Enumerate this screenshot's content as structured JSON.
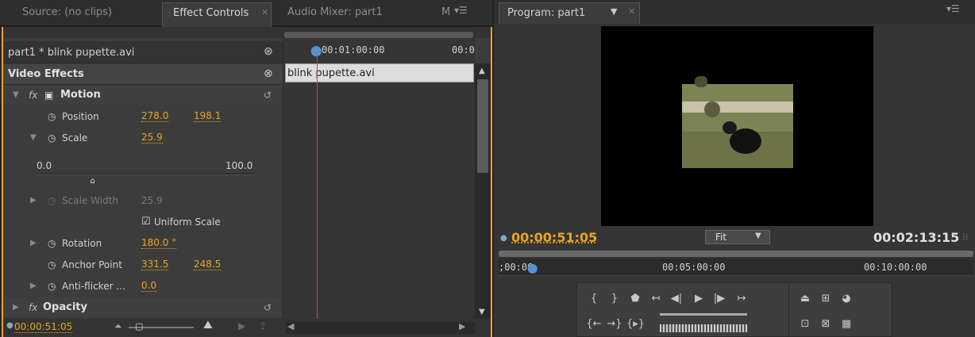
{
  "colors": {
    "accent": "#e8a51e",
    "playhead": "#d8414f",
    "panel": "#3c3c3c"
  },
  "left_tabs": {
    "source": "Source: (no clips)",
    "effect_controls": "Effect Controls",
    "audio_mixer": "Audio Mixer: part1",
    "more": "M"
  },
  "effect_controls": {
    "clip_name": "part1 * blink pupette.avi",
    "video_effects": "Video Effects",
    "motion": "Motion",
    "fx": "fx",
    "position_label": "Position",
    "position_x": "278.0",
    "position_y": "198.1",
    "scale_label": "Scale",
    "scale_value": "25.9",
    "slider_min": "0.0",
    "slider_max": "100.0",
    "slider_value": 0.259,
    "scale_width_label": "Scale Width",
    "scale_width_value": "25.9",
    "uniform_scale": "Uniform Scale",
    "rotation_label": "Rotation",
    "rotation_value": "180.0 °",
    "anchor_label": "Anchor Point",
    "anchor_x": "331.5",
    "anchor_y": "248.5",
    "antiflicker_label": "Anti-flicker ...",
    "antiflicker_value": "0.0",
    "opacity": "Opacity",
    "timecode": "00:00:51:05"
  },
  "ec_timeline": {
    "time1": "00:01:00:00",
    "time2": "00:0",
    "clip": "blink pupette.avi"
  },
  "program": {
    "tab": "Program: part1",
    "timecode": "00:00:51:05",
    "fit": "Fit",
    "duration": "00:02:13:15",
    "ruler_start": ";00:00",
    "ruler_mid": "00:05:00:00",
    "ruler_end": "00:10:00:00"
  },
  "icons": [
    "stopwatch-icon",
    "reset-icon",
    "play-icon",
    "step-back-icon",
    "step-forward-icon",
    "mark-in-icon",
    "mark-out-icon",
    "lift-icon",
    "extract-icon"
  ]
}
